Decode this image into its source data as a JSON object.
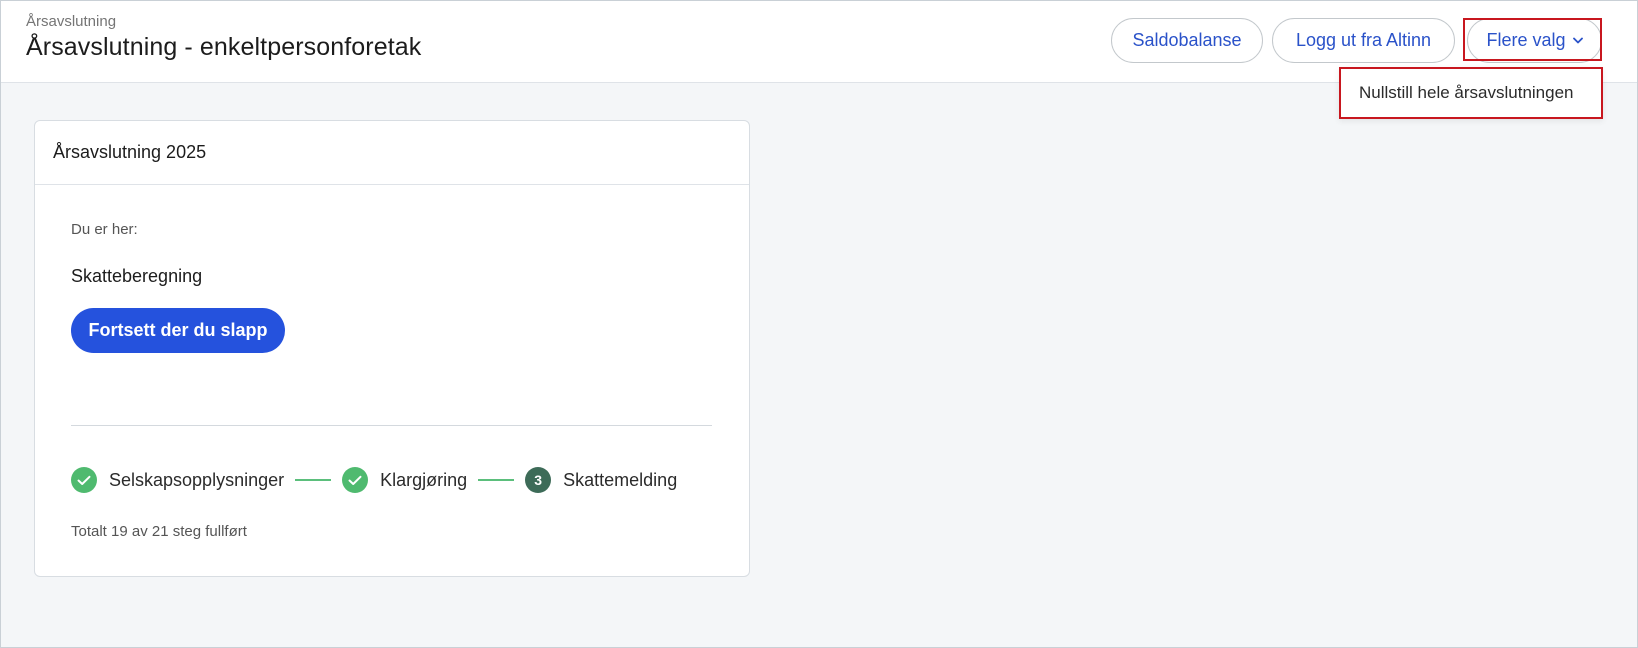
{
  "header": {
    "breadcrumb": "Årsavslutning",
    "title": "Årsavslutning - enkeltpersonforetak",
    "buttons": {
      "saldo": "Saldobalanse",
      "logout": "Logg ut fra Altinn",
      "more": "Flere valg"
    },
    "dropdown": {
      "items": [
        "Nullstill hele årsavslutningen"
      ]
    }
  },
  "card": {
    "title": "Årsavslutning 2025",
    "you_are_here_label": "Du er her:",
    "current_step": "Skatteberegning",
    "continue_label": "Fortsett der du slapp",
    "steps": [
      {
        "label": "Selskapsopplysninger",
        "status": "done"
      },
      {
        "label": "Klargjøring",
        "status": "done"
      },
      {
        "label": "Skattemelding",
        "status": "current",
        "number": "3"
      }
    ],
    "progress_text": "Totalt 19 av 21 steg fullført"
  },
  "colors": {
    "accent": "#2552dd",
    "link": "#2a52c9",
    "done": "#4fba6f",
    "current": "#3d6b58",
    "highlight": "#c8171f"
  }
}
